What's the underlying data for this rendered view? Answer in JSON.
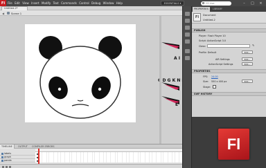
{
  "app": {
    "logo": "Fl"
  },
  "menu": [
    "File",
    "Edit",
    "View",
    "Insert",
    "Modify",
    "Text",
    "Commands",
    "Control",
    "Debug",
    "Window",
    "Help"
  ],
  "workspace": {
    "label": "ESSENTIALS ▾"
  },
  "search": {
    "placeholder": "CS Live"
  },
  "window_controls": [
    "–",
    "□",
    "×"
  ],
  "document": {
    "tab": "Untitled-2*",
    "scene": "Scene 1"
  },
  "stage": {
    "side_labels": [
      "A I",
      "C D G K N R",
      "E"
    ]
  },
  "timeline": {
    "tabs": [
      "TIMELINE",
      "OUTPUT",
      "COMPILER ERRORS"
    ],
    "layers": [
      {
        "name": "labels"
      },
      {
        "name": "graph"
      },
      {
        "name": "panda"
      }
    ]
  },
  "panel": {
    "tabs": [
      "PROPERTIES",
      "LIBRARY"
    ],
    "doc_badge": "Fl",
    "doc_type": "Document",
    "doc_name": "Untitled-2",
    "publish": {
      "header": "PUBLISH",
      "player": "Player: Flash Player 10",
      "script": "Script: ActionScript 3.0",
      "class_label": "Class:",
      "profile": "Profile: Default",
      "edit_button": "Edit...",
      "air_label": "AIR Settings",
      "as_label": "ActionScript Settings",
      "edit_button2": "Edit...",
      "edit_button3": "Edit..."
    },
    "properties": {
      "header": "PROPERTIES",
      "fps_label": "FPS:",
      "fps_value": "24.00",
      "size_label": "Size:",
      "size_value": "550 x 400 px",
      "stage_label": "Stage:",
      "edit_button": "Edit..."
    },
    "swf_history": {
      "header": "SWF HISTORY"
    }
  },
  "colors": {
    "accent": "#c71d22",
    "stage": "#ffffff"
  }
}
